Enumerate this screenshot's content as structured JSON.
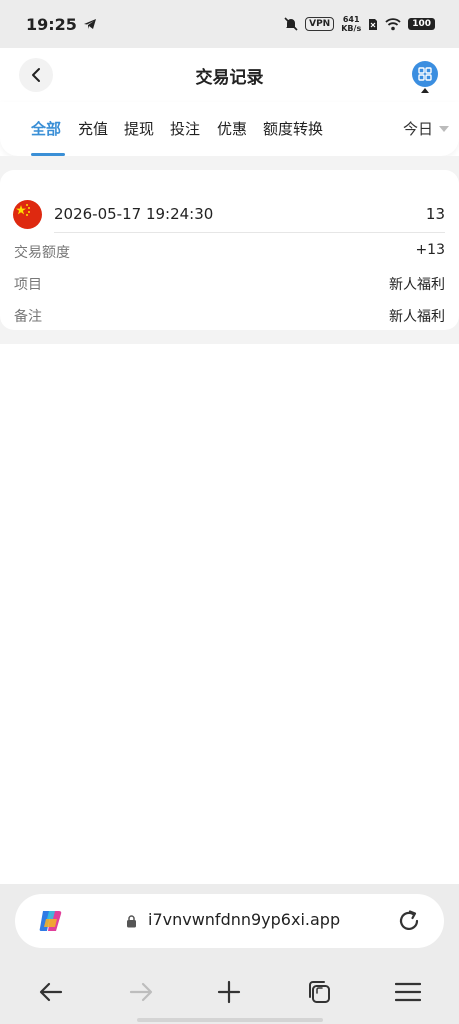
{
  "status_bar": {
    "time": "19:25",
    "vpn": "VPN",
    "speed_value": "641",
    "speed_unit": "KB/s",
    "battery": "100"
  },
  "header": {
    "title": "交易记录"
  },
  "tabs": [
    {
      "label": "全部",
      "active": true
    },
    {
      "label": "充值",
      "active": false
    },
    {
      "label": "提现",
      "active": false
    },
    {
      "label": "投注",
      "active": false
    },
    {
      "label": "优惠",
      "active": false
    },
    {
      "label": "额度转换",
      "active": false
    }
  ],
  "date_filter": {
    "selected": "今日"
  },
  "records": [
    {
      "timestamp": "2026-05-17 19:24:30",
      "amount": "13",
      "fields": [
        {
          "label": "交易额度",
          "value": "+13"
        },
        {
          "label": "项目",
          "value": "新人福利"
        },
        {
          "label": "备注",
          "value": "新人福利"
        }
      ]
    }
  ],
  "browser": {
    "url": "i7vnvwnfdnn9yp6xi.app"
  },
  "colors": {
    "accent": "#3a8fd6",
    "menu_button": "#3b8ee0"
  }
}
